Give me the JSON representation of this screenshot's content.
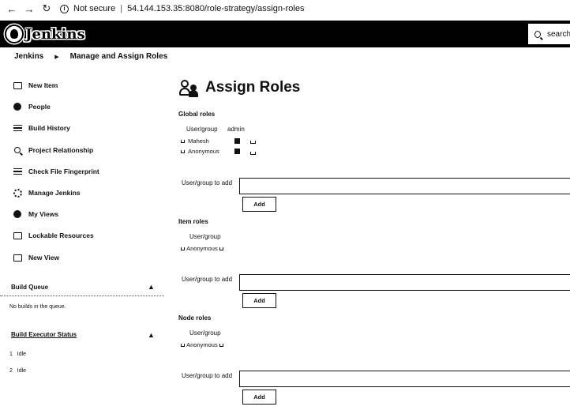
{
  "browser": {
    "security": "Not secure",
    "url": "54.144.153.35:8080/role-strategy/assign-roles"
  },
  "header": {
    "logo_text": "Jenkins",
    "search_placeholder": "search"
  },
  "breadcrumb": [
    "Jenkins",
    "Manage and Assign Roles"
  ],
  "sidebar": {
    "tasks": [
      {
        "label": "New Item",
        "icon": "new-item-icon"
      },
      {
        "label": "People",
        "icon": "people-icon"
      },
      {
        "label": "Build History",
        "icon": "build-history-icon"
      },
      {
        "label": "Project Relationship",
        "icon": "search-icon"
      },
      {
        "label": "Check File Fingerprint",
        "icon": "fingerprint-icon"
      },
      {
        "label": "Manage Jenkins",
        "icon": "gear-icon"
      },
      {
        "label": "My Views",
        "icon": "user-icon"
      },
      {
        "label": "Lockable Resources",
        "icon": "lock-icon"
      },
      {
        "label": "New View",
        "icon": "folder-icon"
      }
    ],
    "build_queue": {
      "title": "Build Queue",
      "empty_text": "No builds in the queue."
    },
    "executors": {
      "title": "Build Executor Status",
      "items": [
        {
          "number": "1",
          "status": "Idle"
        },
        {
          "number": "2",
          "status": "Idle"
        }
      ]
    }
  },
  "main": {
    "title": "Assign Roles",
    "global_roles": {
      "label": "Global roles",
      "col_user": "User/group",
      "col_role": "admin",
      "rows": [
        {
          "name": "Mahesh",
          "checked": true
        },
        {
          "name": "Anonymous",
          "checked": true
        }
      ],
      "add_label": "User/group to add",
      "add_button": "Add"
    },
    "item_roles": {
      "label": "Item roles",
      "col_user": "User/group",
      "rows": [
        {
          "name": "Anonymous"
        }
      ],
      "add_label": "User/group to add",
      "add_button": "Add"
    },
    "node_roles": {
      "label": "Node roles",
      "col_user": "User/group",
      "rows": [
        {
          "name": "Anonymous"
        }
      ],
      "add_label": "User/group to add",
      "add_button": "Add"
    }
  }
}
